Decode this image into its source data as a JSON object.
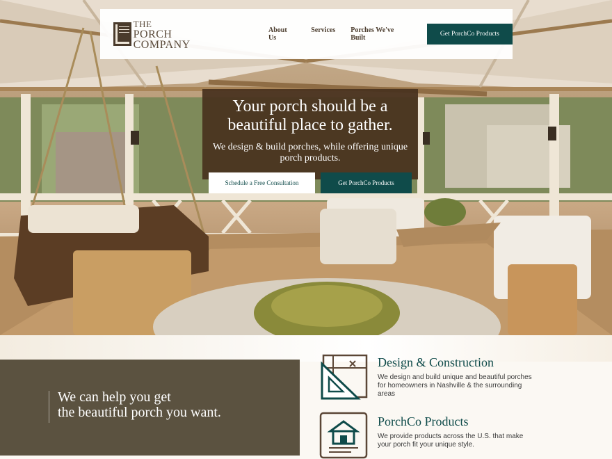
{
  "header": {
    "logo": {
      "line1": "THE",
      "line2": "PORCH COMPANY",
      "mark_text": "THE PORCH COMPANY"
    },
    "nav": [
      {
        "label": "About Us"
      },
      {
        "label": "Services"
      },
      {
        "label": "Porches We've Built"
      }
    ],
    "cta_label": "Get PorchCo Products"
  },
  "hero": {
    "title": "Your porch should be a beautiful place to gather.",
    "subtitle": "We design & build porches, while offering unique porch products.",
    "primary_button": "Schedule a Free Consultation",
    "secondary_button": "Get PorchCo Products"
  },
  "intro": {
    "line1": "We can help you get",
    "line2": "the beautiful porch you want."
  },
  "features": [
    {
      "icon": "blueprint-ruler-icon",
      "title": "Design & Construction",
      "text": "We design and build unique and beautiful porches for homeowners in Nashville & the surrounding areas"
    },
    {
      "icon": "house-products-icon",
      "title": "PorchCo Products",
      "text": "We provide products across the U.S. that make your porch fit your unique style."
    }
  ],
  "colors": {
    "brand_teal": "#0f4b4a",
    "brand_brown": "#4a3b2c",
    "panel_olive": "#5b5240"
  }
}
